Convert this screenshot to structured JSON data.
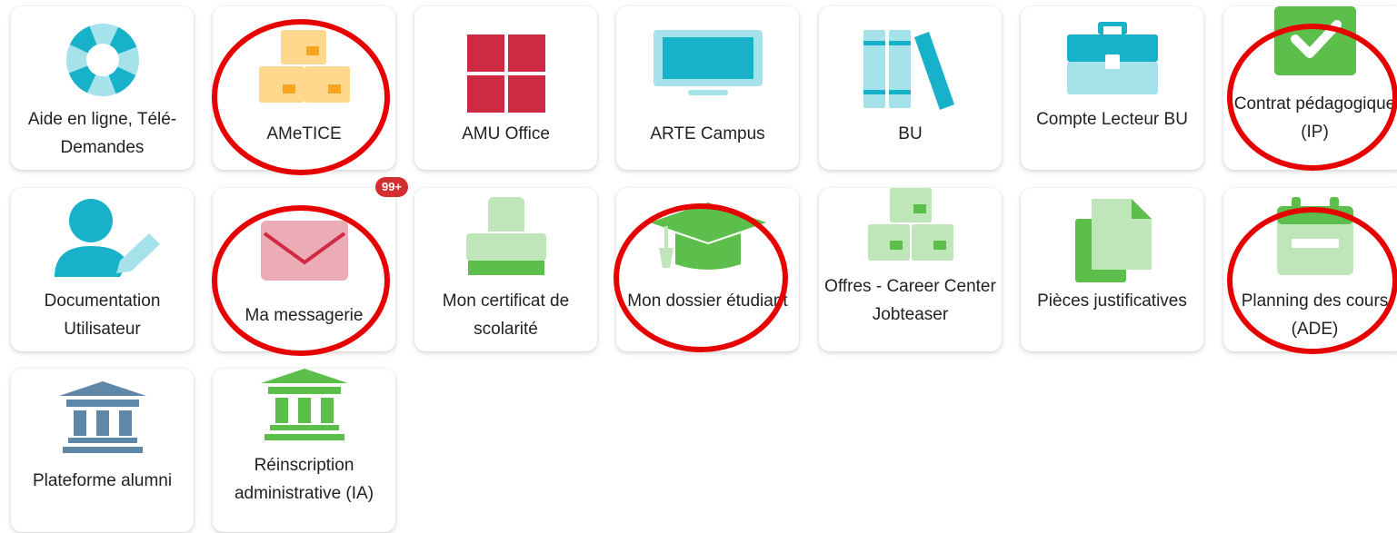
{
  "apps": [
    {
      "label": "Aide en ligne, Télé-Demandes",
      "icon": "lifebuoy-icon"
    },
    {
      "label": "AMeTICE",
      "icon": "boxes-icon"
    },
    {
      "label": "AMU Office",
      "icon": "office-grid-icon"
    },
    {
      "label": "ARTE Campus",
      "icon": "monitor-icon"
    },
    {
      "label": "BU",
      "icon": "books-icon"
    },
    {
      "label": "Compte Lecteur BU",
      "icon": "toolbox-icon"
    },
    {
      "label": "Contrat pédagogique (IP)",
      "icon": "checkmark-icon"
    },
    {
      "label": "Documentation Utilisateur",
      "icon": "user-edit-icon"
    },
    {
      "label": "Ma messagerie",
      "icon": "envelope-icon",
      "badge": "99+"
    },
    {
      "label": "Mon certificat de scolarité",
      "icon": "stamp-icon"
    },
    {
      "label": "Mon dossier étudiant",
      "icon": "graduation-cap-icon"
    },
    {
      "label": "Offres - Career Center Jobteaser",
      "icon": "boxes-icon"
    },
    {
      "label": "Pièces justificatives",
      "icon": "documents-icon"
    },
    {
      "label": "Planning des cours (ADE)",
      "icon": "calendar-icon"
    },
    {
      "label": "Plateforme alumni",
      "icon": "institution-icon"
    },
    {
      "label": "Réinscription administrative (IA)",
      "icon": "institution-icon"
    }
  ],
  "colors": {
    "cyan": "#17b2c9",
    "cyan_light": "#a5e2ea",
    "orange": "#f5a51e",
    "orange_light": "#ffd88e",
    "red": "#cf2a44",
    "green": "#5cbf4b",
    "green_light": "#bfe6b8",
    "pink": "#ecacb6",
    "blue_grey": "#5f87a8",
    "badge": "#d32f2f",
    "annotation": "#e60000"
  },
  "annotations": {
    "circled_apps": [
      "AMeTICE",
      "Contrat pédagogique (IP)",
      "Ma messagerie",
      "Mon dossier étudiant",
      "Planning des cours (ADE)"
    ]
  }
}
